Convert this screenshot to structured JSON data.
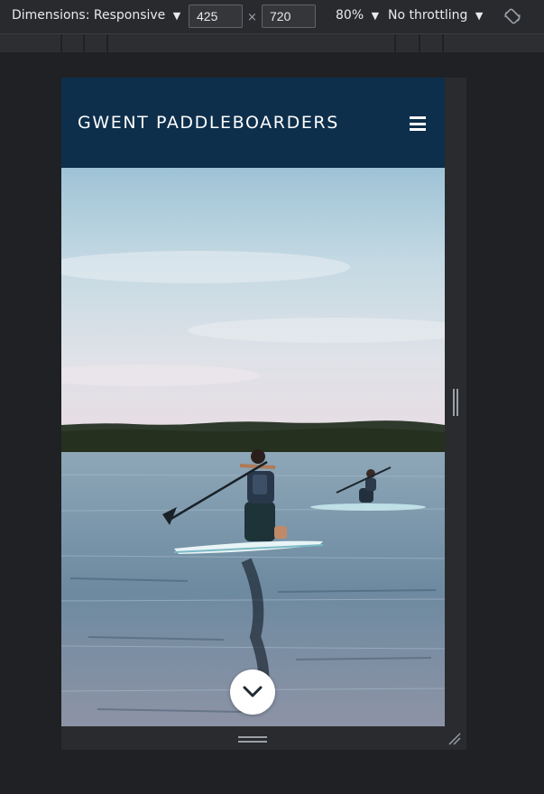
{
  "devtools": {
    "dimensions_label": "Dimensions: Responsive",
    "dropdown_arrow": "▼",
    "width_value": "425",
    "height_value": "720",
    "times": "×",
    "zoom_label": "80%",
    "throttle_label": "No throttling"
  },
  "site": {
    "title": "GWENT PADDLEBOARDERS",
    "menu_icon": "hamburger-icon",
    "scroll_icon": "chevron-down-icon"
  },
  "colors": {
    "header_bg": "#0d2f4b",
    "devtools_bg": "#292a2d",
    "page_bg": "#202124"
  }
}
